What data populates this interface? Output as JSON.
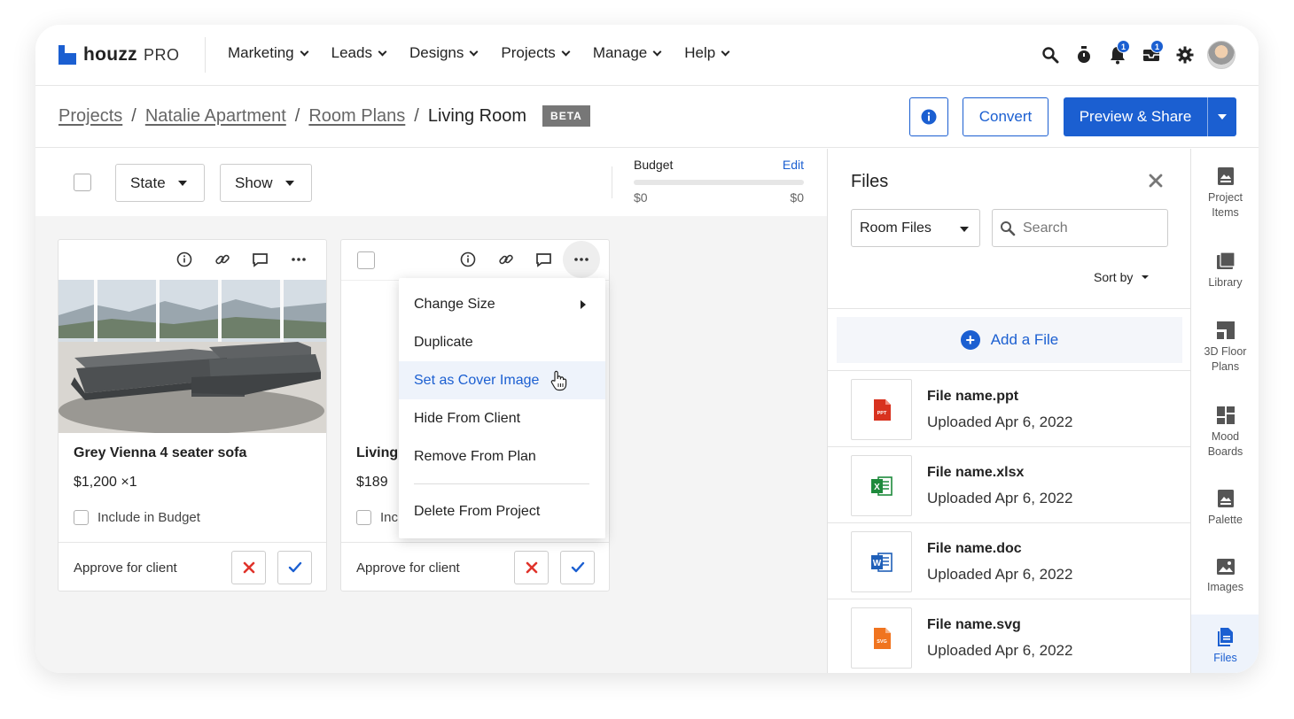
{
  "nav": {
    "logo_text": "houzz",
    "logo_suffix": "PRO",
    "menu": [
      {
        "label": "Marketing"
      },
      {
        "label": "Leads"
      },
      {
        "label": "Designs"
      },
      {
        "label": "Projects"
      },
      {
        "label": "Manage"
      },
      {
        "label": "Help"
      }
    ],
    "notifications_badge": "1",
    "messages_badge": "1"
  },
  "breadcrumb": {
    "items": [
      "Projects",
      "Natalie Apartment",
      "Room Plans"
    ],
    "current": "Living Room",
    "badge": "BETA"
  },
  "actions": {
    "convert_label": "Convert",
    "share_label": "Preview & Share"
  },
  "toolbar": {
    "state_label": "State",
    "show_label": "Show",
    "budget_label": "Budget",
    "budget_edit": "Edit",
    "budget_min": "$0",
    "budget_max": "$0"
  },
  "cards": [
    {
      "title": "Grey Vienna 4 seater sofa",
      "price": "$1,200 ×1",
      "budget_label": "Include in Budget",
      "approve_label": "Approve for client"
    },
    {
      "title": "Living",
      "price": "$189",
      "budget_label": "Incl",
      "approve_label": "Approve for client"
    }
  ],
  "context_menu": {
    "items": [
      "Change Size",
      "Duplicate",
      "Set as Cover Image",
      "Hide From Client",
      "Remove From Plan",
      "Delete From Project"
    ],
    "highlighted": "Set as Cover Image"
  },
  "files_panel": {
    "title": "Files",
    "filter_value": "Room Files",
    "search_placeholder": "Search",
    "sort_label": "Sort by",
    "add_label": "Add a File",
    "files": [
      {
        "name": "File name.ppt",
        "uploaded": "Uploaded Apr 6, 2022",
        "type_tag": "PPT",
        "color": "#d8321f"
      },
      {
        "name": "File name.xlsx",
        "uploaded": "Uploaded Apr 6, 2022",
        "type_tag": "X",
        "color": "#1e8a3c"
      },
      {
        "name": "File name.doc",
        "uploaded": "Uploaded Apr 6, 2022",
        "type_tag": "W",
        "color": "#1f5fb8"
      },
      {
        "name": "File name.svg",
        "uploaded": "Uploaded Apr 6, 2022",
        "type_tag": "SVG",
        "color": "#f0741f"
      }
    ]
  },
  "rail": {
    "items": [
      {
        "label_1": "Project",
        "label_2": "Items"
      },
      {
        "label_1": "Library",
        "label_2": ""
      },
      {
        "label_1": "3D Floor",
        "label_2": "Plans"
      },
      {
        "label_1": "Mood",
        "label_2": "Boards"
      },
      {
        "label_1": "Palette",
        "label_2": ""
      },
      {
        "label_1": "Images",
        "label_2": ""
      },
      {
        "label_1": "Files",
        "label_2": ""
      }
    ],
    "active": "Files"
  },
  "colors": {
    "accent": "#1b5fd1",
    "reject": "#e0332b"
  }
}
